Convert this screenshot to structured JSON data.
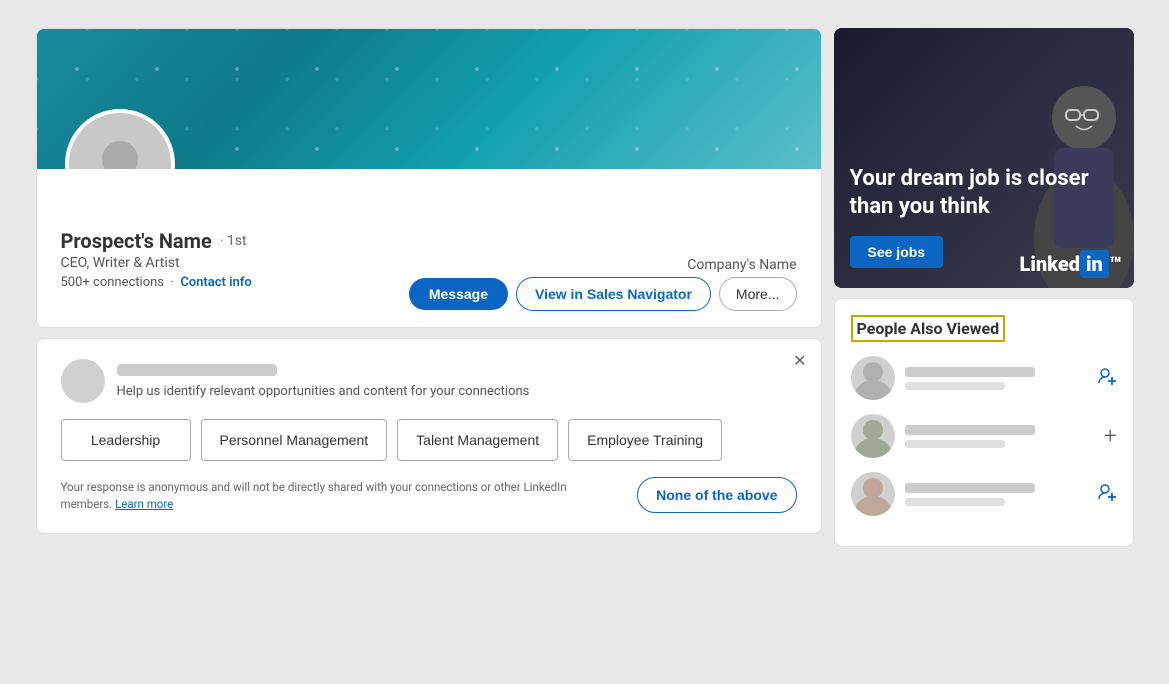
{
  "profile": {
    "name": "Prospect's Name",
    "degree": "· 1st",
    "title": "CEO, Writer & Artist",
    "connections": "500+ connections",
    "contact_info_label": "Contact info",
    "company_name": "Company's Name",
    "btn_message": "Message",
    "btn_sales_nav": "View in Sales Navigator",
    "btn_more": "More..."
  },
  "widget": {
    "subtitle": "Help us identify relevant opportunities and content for your connections",
    "skills": [
      {
        "id": "leadership",
        "label": "Leadership"
      },
      {
        "id": "personnel-management",
        "label": "Personnel Management"
      },
      {
        "id": "talent-management",
        "label": "Talent Management"
      },
      {
        "id": "employee-training",
        "label": "Employee Training"
      }
    ],
    "disclaimer": "Your response is anonymous and will not be directly shared with your connections or other LinkedIn members.",
    "learn_more": "Learn more",
    "btn_none_above": "None of the above"
  },
  "ad": {
    "title": "Your dream job is closer than you think",
    "btn_label": "See jobs",
    "logo_text": "Linked",
    "logo_in": "in"
  },
  "pav": {
    "section_title": "People Also Viewed",
    "people": [
      {
        "id": 1,
        "action": "add"
      },
      {
        "id": 2,
        "action": "plus"
      },
      {
        "id": 3,
        "action": "add"
      }
    ]
  }
}
